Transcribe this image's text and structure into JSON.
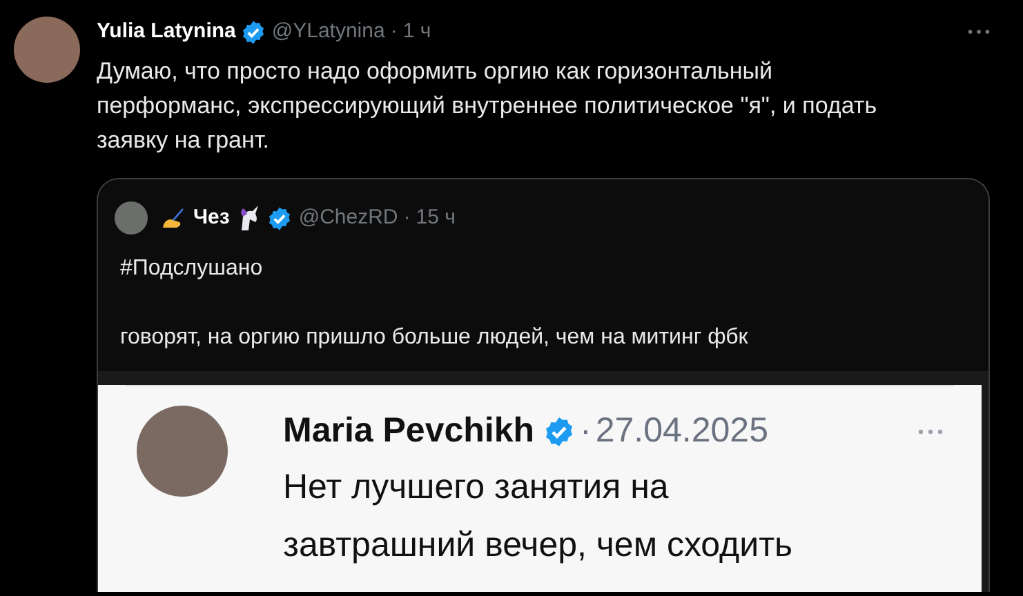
{
  "tweet": {
    "name": "Yulia Latynina",
    "verified": true,
    "handle": "@YLatynina",
    "separator": "·",
    "time": "1 ч",
    "text": "Думаю, что просто надо оформить оргию как горизонтальный перформанс, экспрессирующий внутреннее политическое \"я\", и подать заявку на грант.",
    "quote": {
      "name": "Чез",
      "verified": true,
      "handle": "@ChezRD",
      "separator": "·",
      "time": "15 ч",
      "paragraphs": [
        "#Подслушано",
        "говорят, на оргию пришло больше людей, чем на митинг фбк"
      ],
      "screenshot": {
        "name": "Maria Pevchikh",
        "verified": true,
        "separator": "·",
        "date": "27.04.2025",
        "lines": [
          "Нет лучшего занятия на",
          "завтрашний вечер, чем сходить"
        ]
      }
    }
  }
}
